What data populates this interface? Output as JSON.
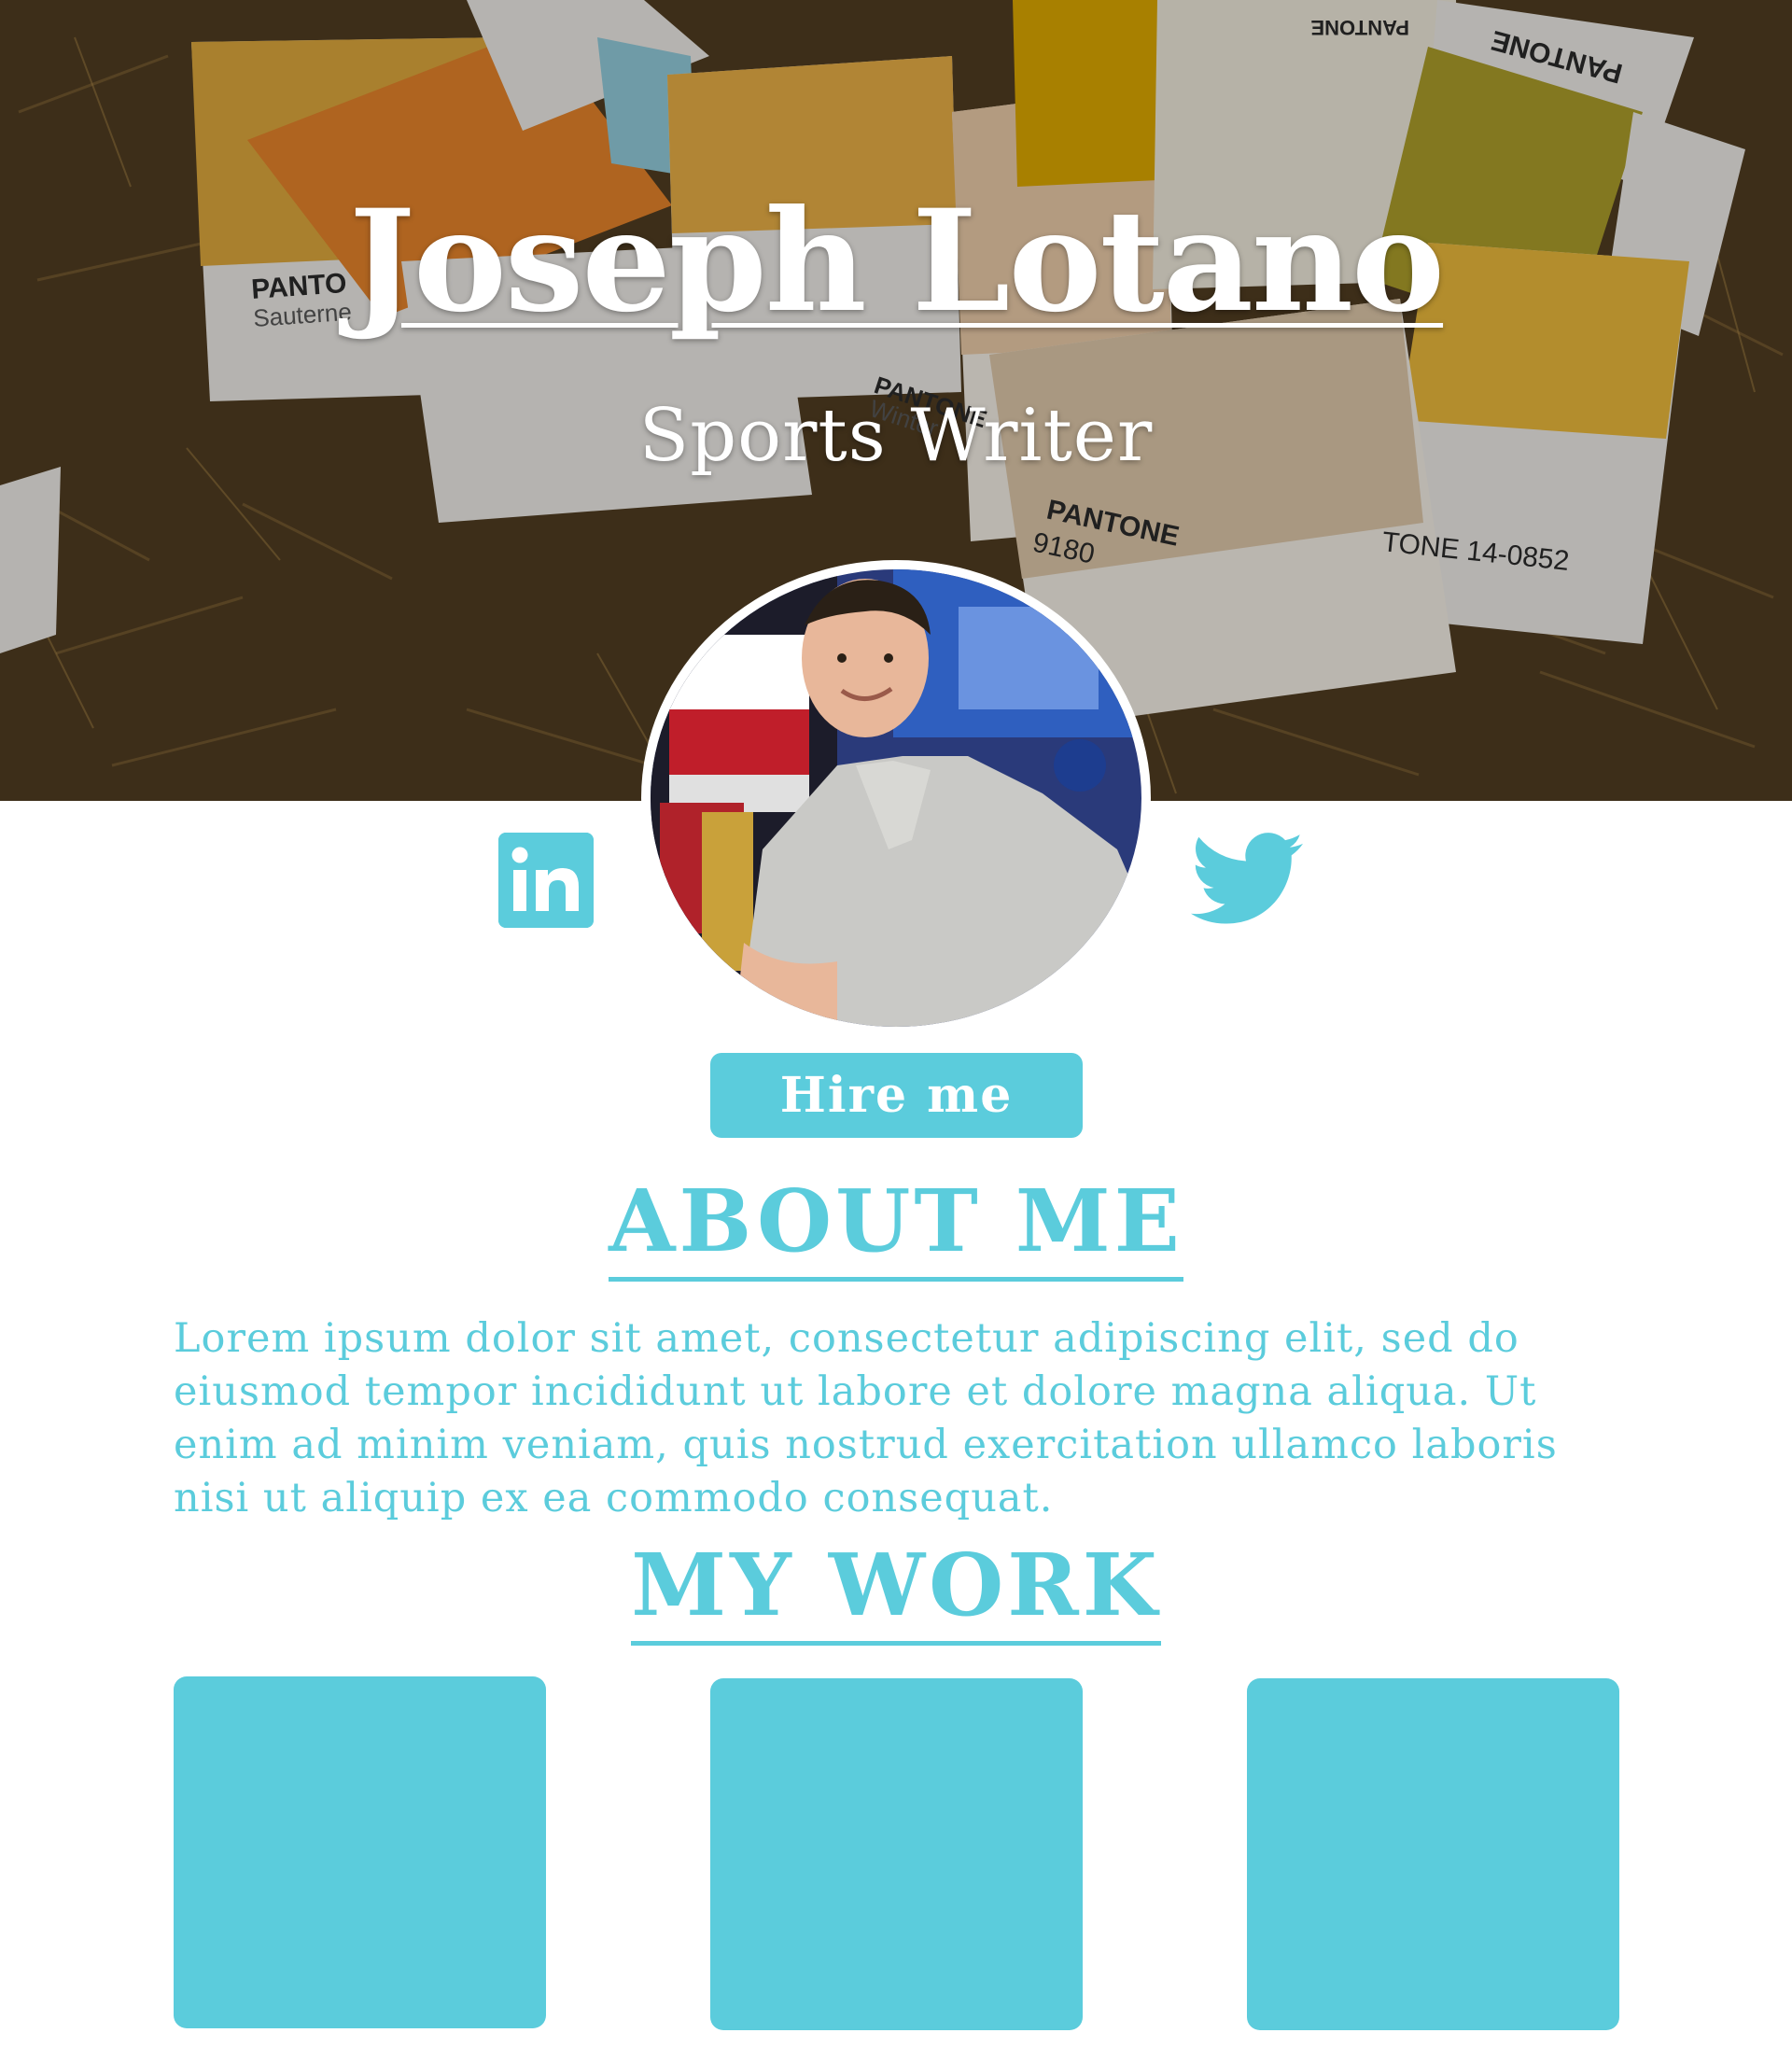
{
  "hero": {
    "name": "Joseph Lotano",
    "role": "Sports Writer",
    "background_image": "pantone-swatches-on-grass"
  },
  "profile": {
    "avatar": "profile-photo"
  },
  "social": {
    "linkedin_icon": "linkedin-icon",
    "twitter_icon": "twitter-icon"
  },
  "cta": {
    "hire_label": "Hire me"
  },
  "about": {
    "heading": "ABOUT ME",
    "body": "Lorem ipsum dolor sit amet, consectetur adipiscing elit, sed do eiusmod tempor incididunt ut labore et dolore magna aliqua. Ut enim ad minim veniam, quis nostrud exercitation ullamco laboris nisi ut aliquip ex ea commodo consequat."
  },
  "work": {
    "heading": "MY WORK",
    "tile_count": 3
  },
  "colors": {
    "accent": "#5bccdc",
    "background": "#ffffff",
    "hero_text": "#ffffff"
  }
}
